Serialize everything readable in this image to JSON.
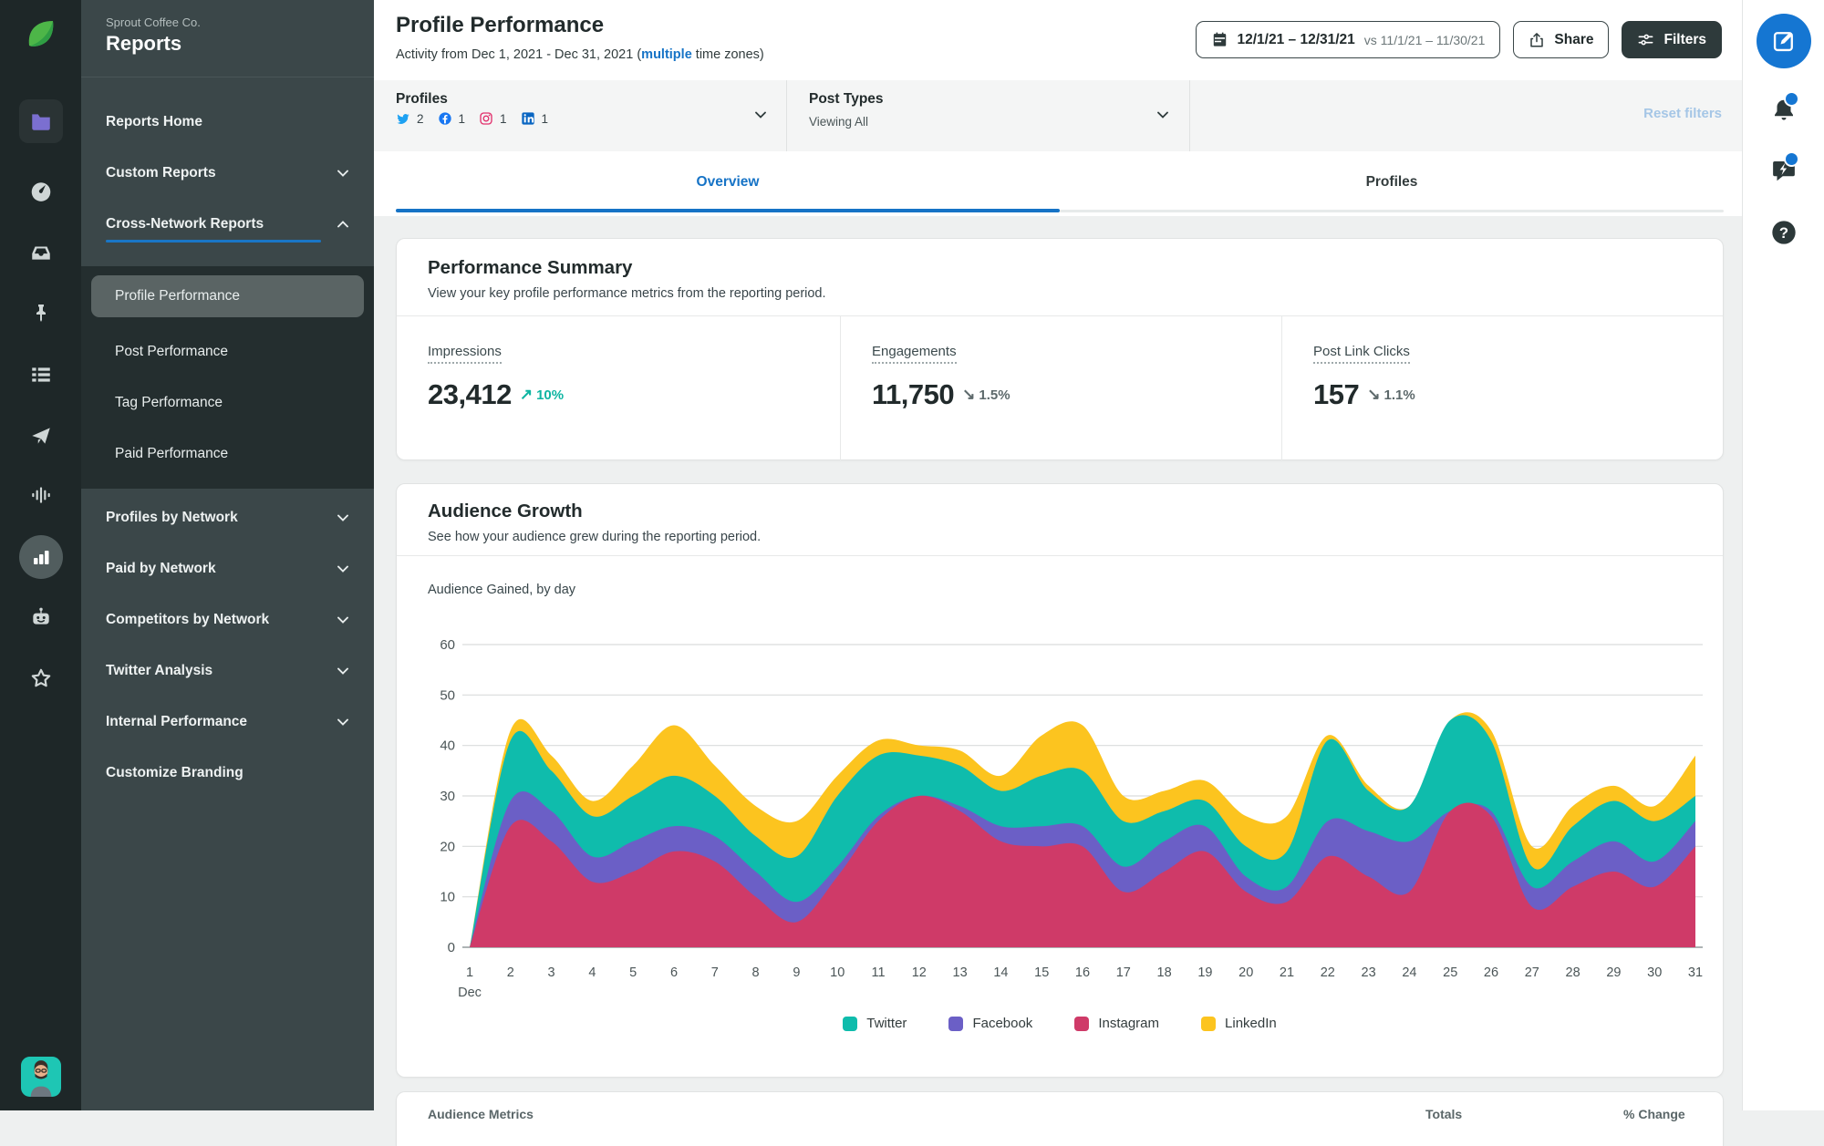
{
  "app": {
    "name_small": "Sprout Coffee Co.",
    "name_big": "Reports"
  },
  "left_rail": {
    "icons": [
      "sprout-logo",
      "folder",
      "gauge",
      "inbox",
      "pin",
      "feeds",
      "paper-plane",
      "listening",
      "reports-bars",
      "bot",
      "star",
      "user-avatar"
    ]
  },
  "sidebar": {
    "sections": [
      {
        "type": "main",
        "items": [
          {
            "label": "Reports Home"
          },
          {
            "label": "Custom Reports",
            "chevron": "down"
          },
          {
            "label": "Cross-Network Reports",
            "chevron": "up",
            "underlined": true
          }
        ]
      },
      {
        "type": "submenu",
        "items": [
          {
            "label": "Profile Performance",
            "selected": true
          },
          {
            "label": "Post Performance"
          },
          {
            "label": "Tag Performance"
          },
          {
            "label": "Paid Performance"
          }
        ]
      },
      {
        "type": "main",
        "items": [
          {
            "label": "Profiles by Network",
            "chevron": "down"
          },
          {
            "label": "Paid by Network",
            "chevron": "down"
          },
          {
            "label": "Competitors by Network",
            "chevron": "down"
          },
          {
            "label": "Twitter Analysis",
            "chevron": "down"
          },
          {
            "label": "Internal Performance",
            "chevron": "down"
          },
          {
            "label": "Customize Branding"
          }
        ]
      }
    ]
  },
  "header": {
    "title": "Profile Performance",
    "subtitle_prefix": "Activity from Dec 1, 2021 - Dec 31, 2021 (",
    "subtitle_link": "multiple",
    "subtitle_suffix": " time zones)",
    "date_range": "12/1/21 – 12/31/21",
    "date_compare": "vs 11/1/21 – 11/30/21",
    "share_label": "Share",
    "filters_label": "Filters"
  },
  "filter_bar": {
    "profiles_label": "Profiles",
    "networks": [
      {
        "name": "Twitter",
        "count": "2",
        "color": "#1da1f2"
      },
      {
        "name": "Facebook",
        "count": "1",
        "color": "#1877f2"
      },
      {
        "name": "Instagram",
        "count": "1",
        "color": "#e1306c"
      },
      {
        "name": "LinkedIn",
        "count": "1",
        "color": "#0a66c2"
      }
    ],
    "post_types_label": "Post Types",
    "post_types_value": "Viewing All",
    "reset_label": "Reset filters"
  },
  "tabs": [
    {
      "label": "Overview",
      "active": true
    },
    {
      "label": "Profiles",
      "active": false
    }
  ],
  "performance_summary": {
    "title": "Performance Summary",
    "subtitle": "View your key profile performance metrics from the reporting period.",
    "metrics": [
      {
        "label": "Impressions",
        "value": "23,412",
        "direction": "up",
        "change": "10%",
        "color": "#0eb5a2"
      },
      {
        "label": "Engagements",
        "value": "11,750",
        "direction": "down",
        "change": "1.5%",
        "color": "#5d696b"
      },
      {
        "label": "Post Link Clicks",
        "value": "157",
        "direction": "down",
        "change": "1.1%",
        "color": "#5d696b"
      }
    ]
  },
  "audience_growth": {
    "title": "Audience Growth",
    "subtitle": "See how your audience grew during the reporting period.",
    "chart_label": "Audience Gained, by day"
  },
  "chart_data": {
    "type": "area",
    "stacked": true,
    "title": "Audience Gained, by day",
    "x": [
      1,
      2,
      3,
      4,
      5,
      6,
      7,
      8,
      9,
      10,
      11,
      12,
      13,
      14,
      15,
      16,
      17,
      18,
      19,
      20,
      21,
      22,
      23,
      24,
      25,
      26,
      27,
      28,
      29,
      30,
      31
    ],
    "x_month_label": "Dec",
    "ylim": [
      0,
      60
    ],
    "yticks": [
      0,
      10,
      20,
      30,
      40,
      50,
      60
    ],
    "grid": true,
    "legend_position": "bottom",
    "stack_order_bottom_to_top": [
      "Instagram",
      "Facebook",
      "Twitter",
      "LinkedIn"
    ],
    "series": [
      {
        "name": "Twitter",
        "color": "#0fbcac",
        "values": [
          0,
          12,
          8,
          8,
          9,
          10,
          8,
          7,
          9,
          14,
          12,
          8,
          8,
          7,
          10,
          11,
          9,
          6,
          5,
          6,
          7,
          16,
          8,
          7,
          18,
          14,
          4,
          7,
          8,
          8,
          5
        ]
      },
      {
        "name": "Facebook",
        "color": "#6b5fc6",
        "values": [
          0,
          5,
          6,
          5,
          6,
          5,
          5,
          5,
          4,
          2,
          1,
          0,
          1,
          3,
          4,
          4,
          5,
          6,
          5,
          3,
          3,
          7,
          9,
          10,
          0,
          1,
          4,
          5,
          6,
          5,
          5
        ]
      },
      {
        "name": "Instagram",
        "color": "#cf3a68",
        "values": [
          0,
          24,
          21,
          13,
          15,
          19,
          17,
          10,
          5,
          14,
          25,
          30,
          27,
          21,
          20,
          20,
          11,
          15,
          19,
          11,
          9,
          18,
          14,
          11,
          27,
          26,
          8,
          12,
          15,
          12,
          20
        ]
      },
      {
        "name": "LinkedIn",
        "color": "#fcc41f",
        "values": [
          0,
          2,
          3,
          3,
          6,
          10,
          6,
          6,
          7,
          4,
          3,
          2,
          3,
          3,
          8,
          9,
          5,
          4,
          4,
          6,
          7,
          1,
          1,
          0,
          0,
          2,
          4,
          4,
          3,
          3,
          8
        ]
      }
    ]
  },
  "audience_table": {
    "title": "Audience Metrics",
    "totals_label": "Totals",
    "change_label": "% Change"
  },
  "colors": {
    "accent_blue": "#1673c6",
    "teal": "#0eb5a2",
    "dark_button": "#2e3a3b"
  }
}
